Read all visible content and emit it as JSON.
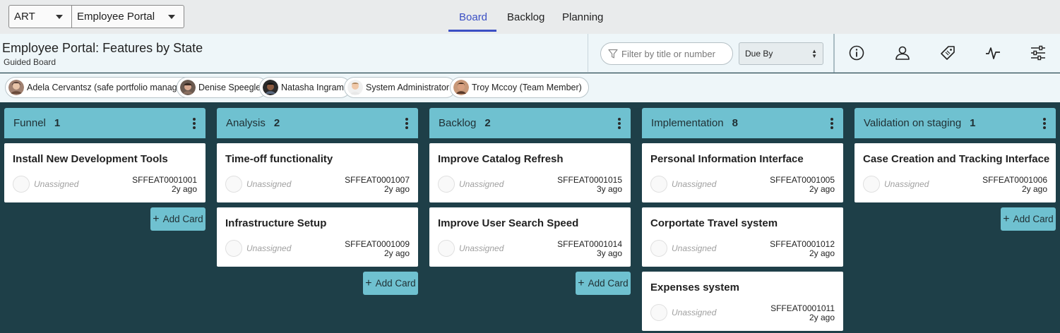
{
  "topbar": {
    "art_select": "ART",
    "portal_select": "Employee Portal",
    "tabs": [
      {
        "label": "Board"
      },
      {
        "label": "Backlog"
      },
      {
        "label": "Planning"
      }
    ]
  },
  "header": {
    "title": "Employee Portal: Features by State",
    "subtitle": "Guided Board",
    "filter_placeholder": "Filter by title or number",
    "sort_select": "Due By",
    "icons": [
      "info-icon",
      "user-icon",
      "tag-icon",
      "activity-icon",
      "settings-sliders-icon"
    ]
  },
  "users": [
    {
      "name": "Adela Cervantsz (safe portfolio manager)"
    },
    {
      "name": "Denise Speegle"
    },
    {
      "name": "Natasha Ingram"
    },
    {
      "name": "System Administrator"
    },
    {
      "name": "Troy Mccoy (Team Member)"
    }
  ],
  "board": {
    "add_card_label": "Add Card",
    "columns": [
      {
        "name": "Funnel",
        "count": "1",
        "cards": [
          {
            "title": "Install New Development Tools",
            "assignee": "Unassigned",
            "number": "SFFEAT0001001",
            "age": "2y ago"
          }
        ]
      },
      {
        "name": "Analysis",
        "count": "2",
        "cards": [
          {
            "title": "Time-off functionality",
            "assignee": "Unassigned",
            "number": "SFFEAT0001007",
            "age": "2y ago"
          },
          {
            "title": "Infrastructure Setup",
            "assignee": "Unassigned",
            "number": "SFFEAT0001009",
            "age": "2y ago"
          }
        ]
      },
      {
        "name": "Backlog",
        "count": "2",
        "cards": [
          {
            "title": "Improve Catalog Refresh",
            "assignee": "Unassigned",
            "number": "SFFEAT0001015",
            "age": "3y ago"
          },
          {
            "title": "Improve User Search Speed",
            "assignee": "Unassigned",
            "number": "SFFEAT0001014",
            "age": "3y ago"
          }
        ]
      },
      {
        "name": "Implementation",
        "count": "8",
        "cards": [
          {
            "title": "Personal Information Interface",
            "assignee": "Unassigned",
            "number": "SFFEAT0001005",
            "age": "2y ago"
          },
          {
            "title": "Corportate Travel system",
            "assignee": "Unassigned",
            "number": "SFFEAT0001012",
            "age": "2y ago"
          },
          {
            "title": "Expenses system",
            "assignee": "Unassigned",
            "number": "SFFEAT0001011",
            "age": "2y ago"
          }
        ]
      },
      {
        "name": "Validation on staging",
        "count": "1",
        "cards": [
          {
            "title": "Case Creation and Tracking Interface",
            "assignee": "Unassigned",
            "number": "SFFEAT0001006",
            "age": "2y ago"
          }
        ]
      }
    ]
  },
  "colors": {
    "accent": "#3b4fc4",
    "column_header": "#6fc1d0",
    "board_background": "#1e3f48"
  }
}
